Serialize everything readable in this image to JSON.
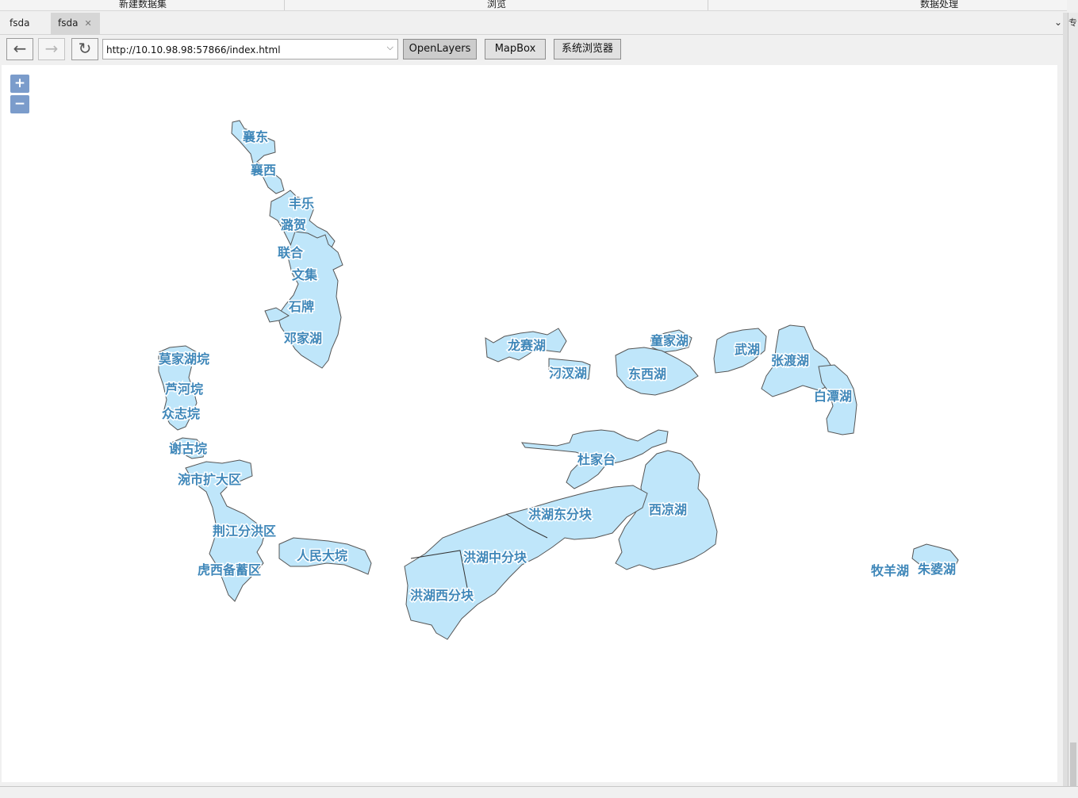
{
  "top_menu": {
    "items": [
      "新建数据集",
      "浏览",
      "数据处理"
    ]
  },
  "tabs": [
    {
      "label": "fsda"
    },
    {
      "label": "fsda",
      "close": "✕"
    }
  ],
  "tab_dropdown": "⌄",
  "toolbar": {
    "back_icon": "←",
    "forward_icon": "→",
    "refresh_icon": "↻",
    "url": "http://10.10.98.98:57866/index.html",
    "url_dropdown_icon": "⌵",
    "buttons": [
      "OpenLayers",
      "MapBox",
      "系统浏览器"
    ]
  },
  "map": {
    "zoom_in": "+",
    "zoom_out": "−",
    "lake_fill": "#bfe6fa",
    "label_color": "#3f87b9",
    "labels": [
      "襄东",
      "襄西",
      "丰乐",
      "潞贺",
      "联合",
      "文集",
      "石牌",
      "邓家湖",
      "莫家湖垸",
      "芦河垸",
      "众志垸",
      "谢古垸",
      "涴市扩大区",
      "荆江分洪区",
      "虎西备蓄区",
      "人民大垸",
      "龙赛湖",
      "汈汊湖",
      "童家湖",
      "东西湖",
      "武湖",
      "张渡湖",
      "白潭湖",
      "杜家台",
      "西凉湖",
      "洪湖东分块",
      "洪湖中分块",
      "洪湖西分块",
      "牧羊湖",
      "朱婆湖"
    ]
  },
  "right_panel": {
    "text": "专"
  }
}
